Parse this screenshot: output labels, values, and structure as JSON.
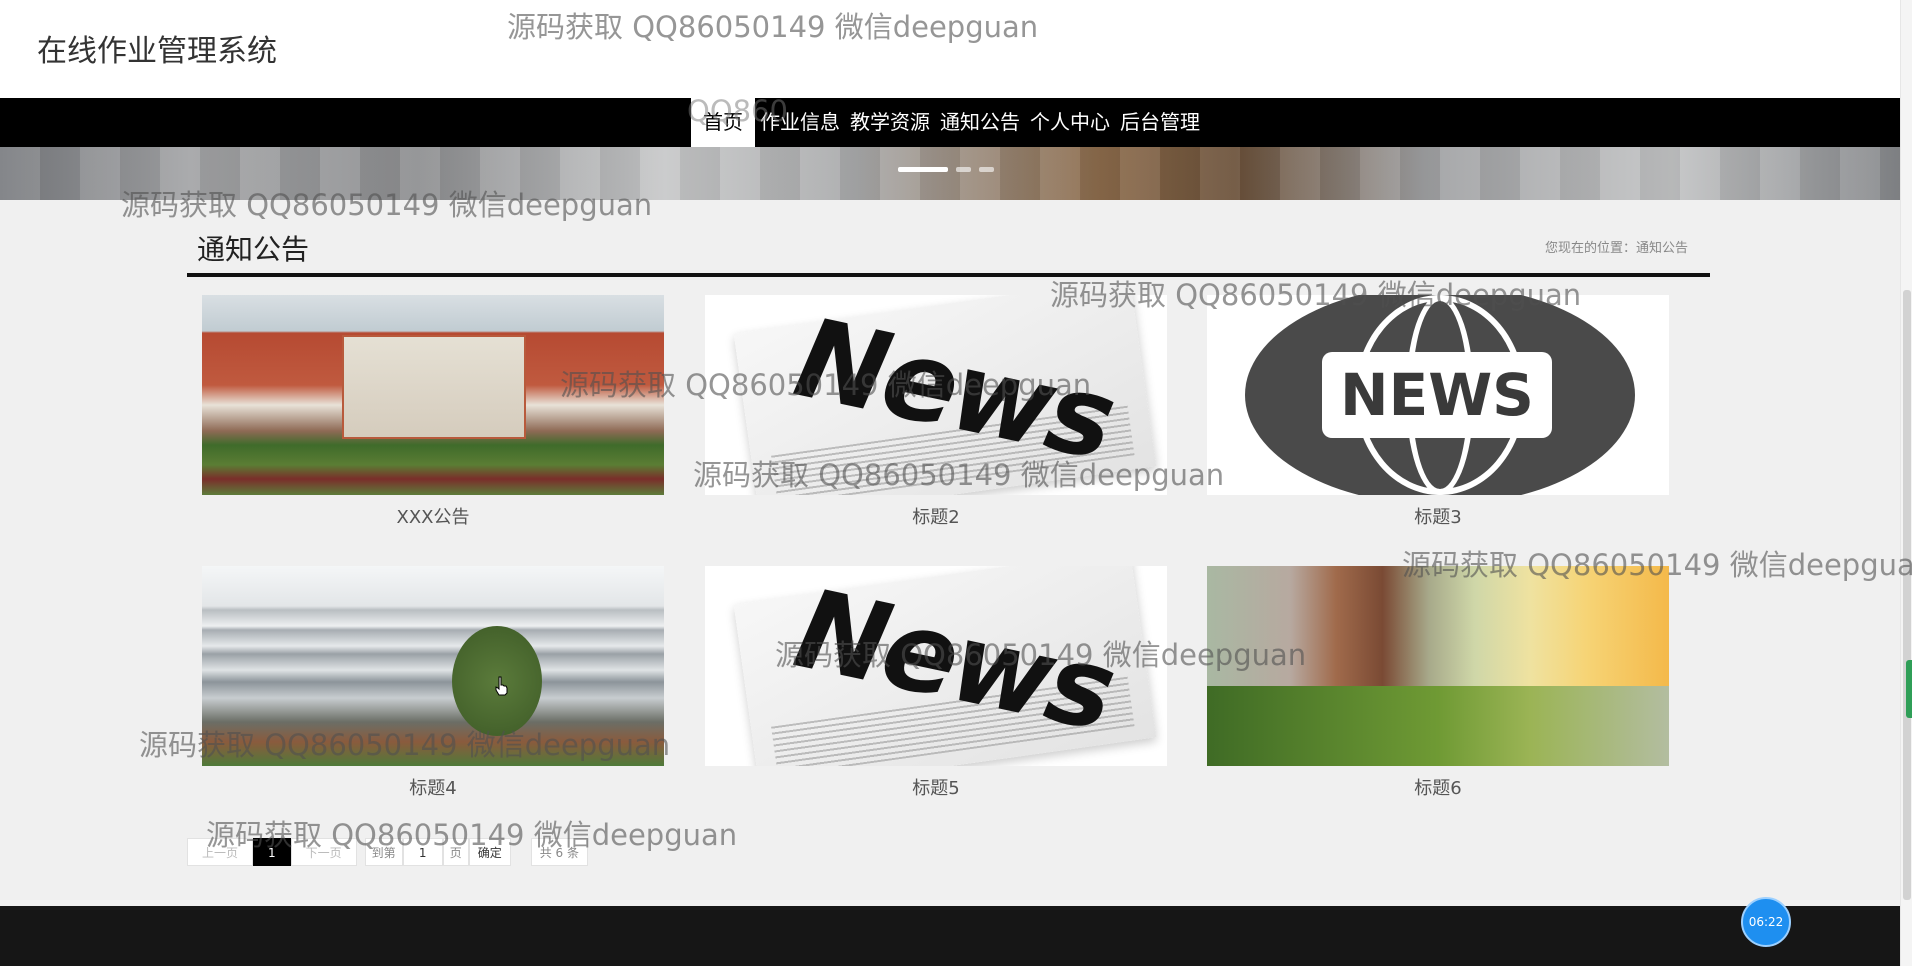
{
  "header": {
    "site_title": "在线作业管理系统"
  },
  "nav": {
    "items": [
      "首页",
      "作业信息",
      "教学资源",
      "通知公告",
      "个人中心",
      "后台管理"
    ],
    "active": "首页"
  },
  "page": {
    "section_title": "通知公告",
    "breadcrumb": "您现在的位置：通知公告"
  },
  "cards": [
    {
      "caption": "XXX公告",
      "image": "campus-photo"
    },
    {
      "caption": "标题2",
      "image": "news-newspaper"
    },
    {
      "caption": "标题3",
      "image": "news-globe-icon"
    },
    {
      "caption": "标题4",
      "image": "building-courtyard-photo"
    },
    {
      "caption": "标题5",
      "image": "news-newspaper"
    },
    {
      "caption": "标题6",
      "image": "trees-sunset-photo"
    }
  ],
  "news_word": "News",
  "news_plate": "NEWS",
  "pagination": {
    "prev": "上一页",
    "current": "1",
    "next": "下一页",
    "goto_label": "到第",
    "goto_value": "1",
    "page_unit": "页",
    "confirm": "确定",
    "total": "共 6 条"
  },
  "timer": "06:22",
  "watermark": "源码获取 QQ86050149 微信deepguan",
  "watermark_fragment": "QQ860",
  "colors": {
    "nav_bg": "#000000",
    "active_nav_bg": "#ffffff",
    "footer_bg": "#161616",
    "timer_bg": "#1e8ff0"
  }
}
